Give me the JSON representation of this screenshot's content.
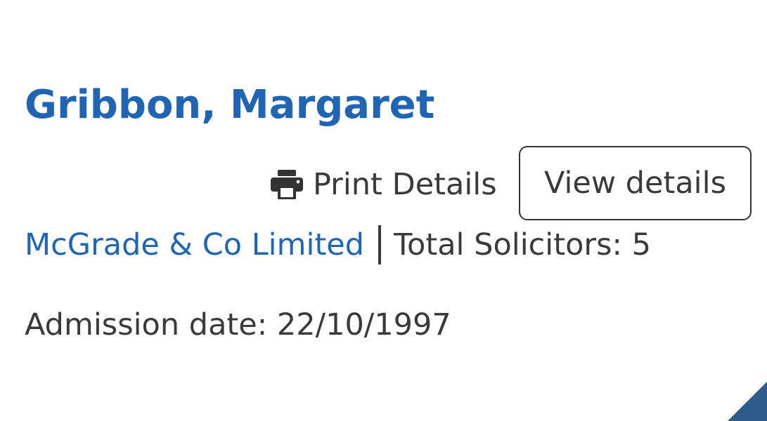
{
  "solicitor": {
    "name": "Gribbon, Margaret",
    "firm_name": "McGrade & Co Limited",
    "total_solicitors_text": "Total Solicitors: 5",
    "admission_text": "Admission date: 22/10/1997"
  },
  "actions": {
    "print_label": "Print Details",
    "view_label": "View details"
  },
  "icons": {
    "print": "printer-icon"
  },
  "colors": {
    "link_blue": "#1f65b4",
    "text": "#3a3a3a",
    "corner_accent": "#2e5c8a"
  }
}
